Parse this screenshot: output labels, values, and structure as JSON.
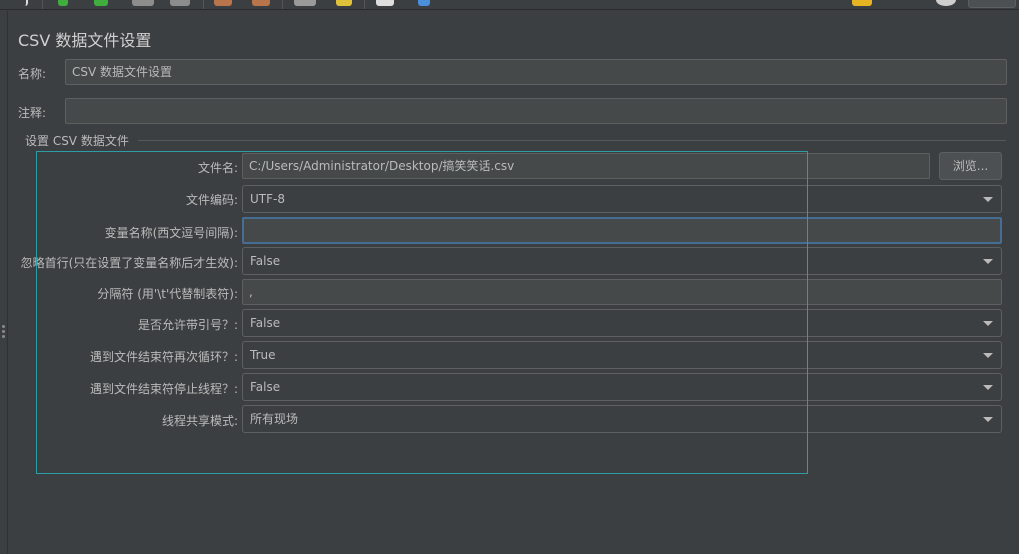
{
  "panel": {
    "title": "CSV 数据文件设置"
  },
  "name_row": {
    "label": "名称:",
    "value": "CSV 数据文件设置"
  },
  "comment_row": {
    "label": "注释:",
    "value": ""
  },
  "group": {
    "title": "设置 CSV 数据文件"
  },
  "fields": {
    "filename": {
      "label": "文件名:",
      "value": "C:/Users/Administrator/Desktop/搞笑笑话.csv",
      "browse_label": "浏览..."
    },
    "encoding": {
      "label": "文件编码:",
      "value": "UTF-8"
    },
    "variable_names": {
      "label": "变量名称(西文逗号间隔):",
      "value": ""
    },
    "ignore_first_line": {
      "label": "忽略首行(只在设置了变量名称后才生效):",
      "value": "False"
    },
    "delimiter": {
      "label": "分隔符 (用'\\t'代替制表符):",
      "value": ","
    },
    "allow_quoted": {
      "label": "是否允许带引号？:",
      "value": "False"
    },
    "recycle_eof": {
      "label": "遇到文件结束符再次循环？:",
      "value": "True"
    },
    "stop_thread_eof": {
      "label": "遇到文件结束符停止线程？:",
      "value": "False"
    },
    "sharing_mode": {
      "label": "线程共享模式:",
      "value": "所有现场"
    }
  },
  "colors": {
    "background": "#3c3f41",
    "field_bg": "#45494a",
    "focus_border": "#466d94",
    "selection_overlay": "#2e9ca3"
  }
}
